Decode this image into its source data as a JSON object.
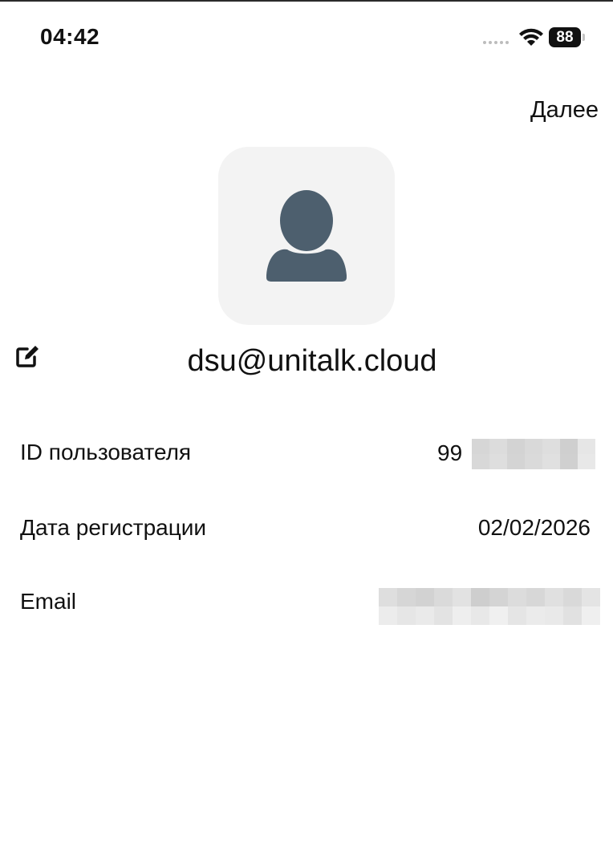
{
  "status_bar": {
    "time": "04:42",
    "battery_level": "88",
    "icons": [
      "signal-dots-icon",
      "wifi-icon",
      "battery-icon"
    ]
  },
  "header": {
    "next_label": "Далее"
  },
  "profile": {
    "avatar_icon": "person-icon",
    "email": "dsu@unitalk.cloud",
    "edit_icon": "edit-icon"
  },
  "details": {
    "user_id_label": "ID пользователя",
    "user_id_value_visible": "99",
    "user_id_value_obscured": true,
    "registration_date_label": "Дата регистрации",
    "registration_date_value": "02/02/2026",
    "email_label": "Email",
    "email_value_obscured": true
  },
  "colors": {
    "background": "#ffffff",
    "text": "#111111",
    "avatar_bg": "#f3f3f3",
    "avatar_icon": "#4d5f6e"
  }
}
